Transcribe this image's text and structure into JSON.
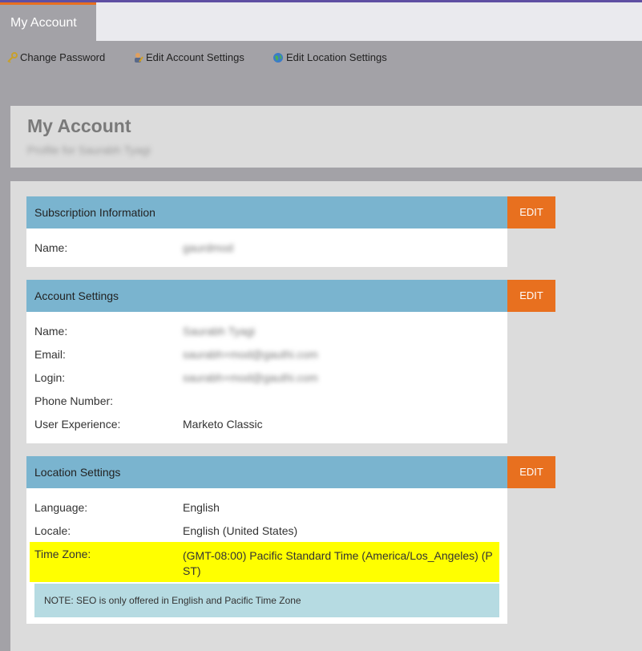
{
  "tab": {
    "label": "My Account"
  },
  "toolbar": {
    "change_password": "Change Password",
    "edit_account": "Edit Account Settings",
    "edit_location": "Edit Location Settings"
  },
  "header": {
    "title": "My Account",
    "subtitle": "Profile for Saurabh Tyagi"
  },
  "subscription": {
    "title": "Subscription Information",
    "edit": "EDIT",
    "name_label": "Name:",
    "name_value": "gaurdmod"
  },
  "account": {
    "title": "Account Settings",
    "edit": "EDIT",
    "name_label": "Name:",
    "name_value": "Saurabh Tyagi",
    "email_label": "Email:",
    "email_value": "saurabh+mod@gauthi.com",
    "login_label": "Login:",
    "login_value": "saurabh+mod@gauthi.com",
    "phone_label": "Phone Number:",
    "phone_value": "",
    "ux_label": "User Experience:",
    "ux_value": "Marketo Classic"
  },
  "location": {
    "title": "Location Settings",
    "edit": "EDIT",
    "language_label": "Language:",
    "language_value": "English",
    "locale_label": "Locale:",
    "locale_value": "English (United States)",
    "tz_label": "Time Zone:",
    "tz_value_line1": "(GMT-08:00) Pacific Standard Time (America/Los_Angeles) (P",
    "tz_value_line2": "ST)",
    "note": "NOTE: SEO is only offered in English and Pacific Time Zone"
  },
  "colors": {
    "accent": "#e8701f",
    "section_header": "#7ab4cf",
    "highlight": "#ffff00"
  }
}
